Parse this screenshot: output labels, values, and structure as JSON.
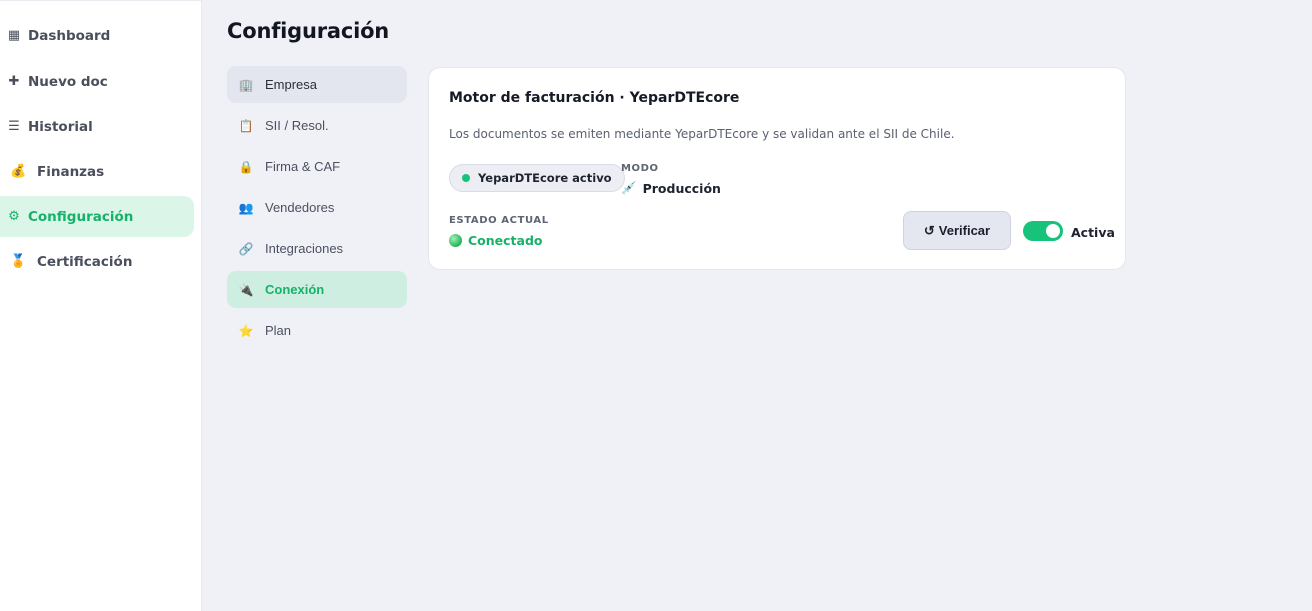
{
  "sidebar": {
    "items": [
      {
        "icon": "▦",
        "label": "Dashboard"
      },
      {
        "icon": "✚",
        "label": "Nuevo doc"
      },
      {
        "icon": "☰",
        "label": "Historial"
      },
      {
        "icon": "💰",
        "label": "Finanzas"
      },
      {
        "icon": "⚙",
        "label": "Configuración"
      },
      {
        "icon": "🏅",
        "label": "Certificación"
      }
    ]
  },
  "page": {
    "title": "Configuración"
  },
  "subnav": {
    "items": [
      {
        "icon": "🏢",
        "label": "Empresa"
      },
      {
        "icon": "📋",
        "label": "SII / Resol."
      },
      {
        "icon": "🔒",
        "label": "Firma & CAF"
      },
      {
        "icon": "👥",
        "label": "Vendedores"
      },
      {
        "icon": "🔗",
        "label": "Integraciones"
      },
      {
        "icon": "🔌",
        "label": "Conexión"
      },
      {
        "icon": "⭐",
        "label": "Plan"
      }
    ]
  },
  "card": {
    "title": "Motor de facturación · YeparDTEcore",
    "description": "Los documentos se emiten mediante YeparDTEcore y se validan ante el SII de Chile.",
    "status_pill": "YeparDTEcore activo",
    "modo_label": "MODO",
    "modo_icon": "💉",
    "modo_value": "Producción",
    "estado_label": "ESTADO ACTUAL",
    "estado_value": "Conectado",
    "verify_icon": "↺",
    "verify_label": "Verificar",
    "toggle_label": "Activa",
    "toggle_on": true
  },
  "colors": {
    "accent": "#17b26a",
    "active_bg": "#dcf5e9",
    "page_bg": "#f0f1f6"
  }
}
